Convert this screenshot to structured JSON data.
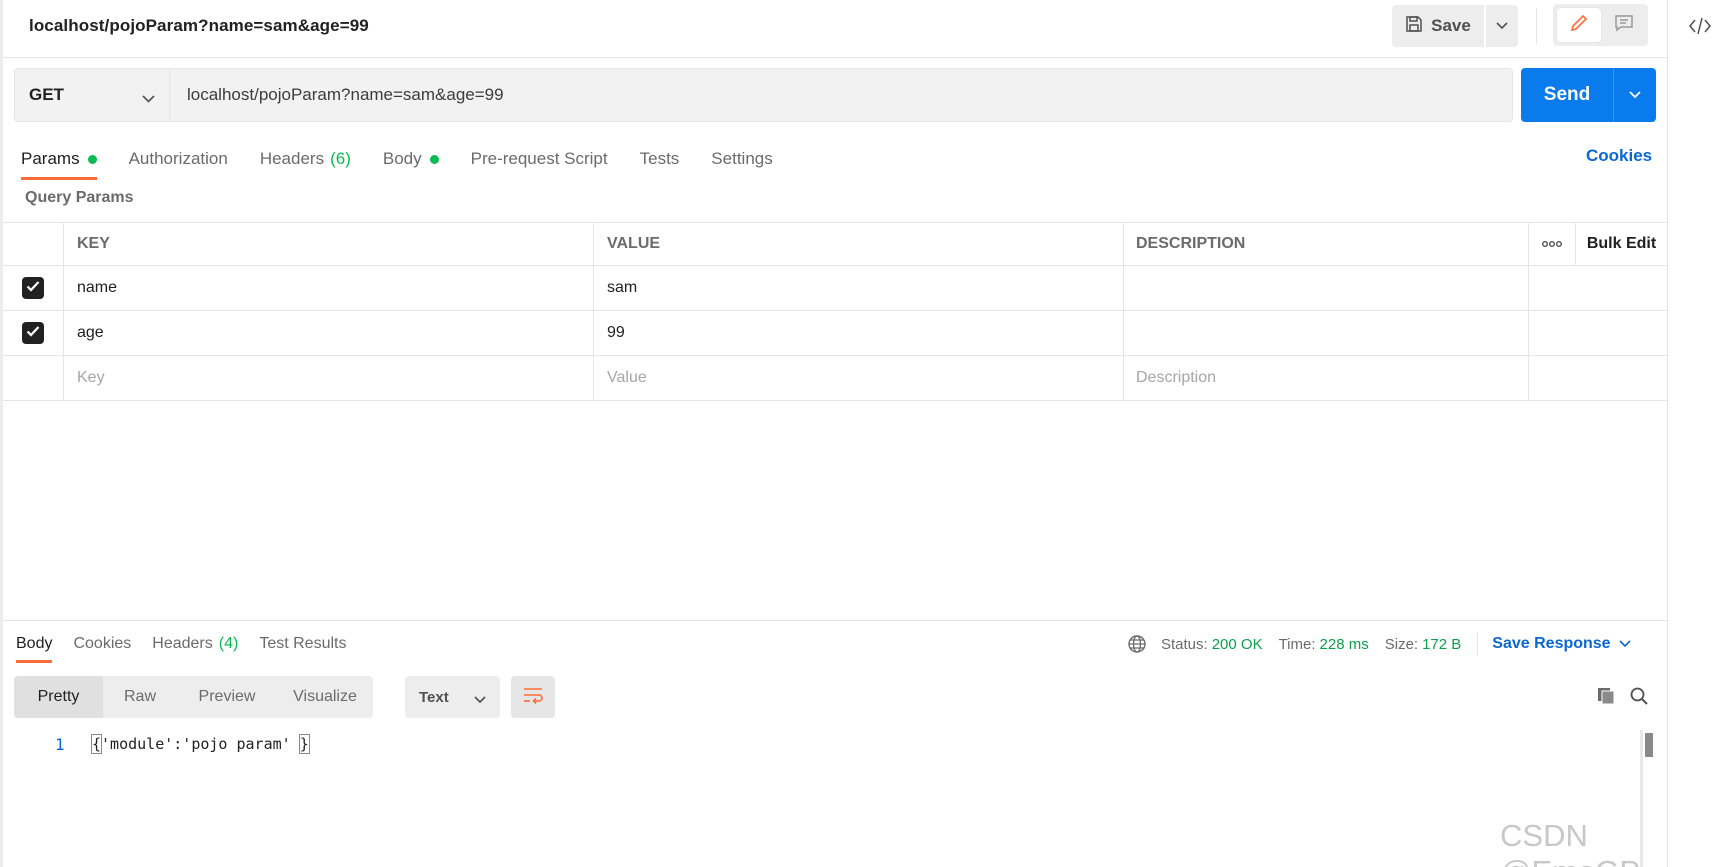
{
  "header": {
    "title": "localhost/pojoParam?name=sam&age=99",
    "save_label": "Save"
  },
  "request": {
    "method": "GET",
    "url": "localhost/pojoParam?name=sam&age=99",
    "send_label": "Send"
  },
  "request_tabs": {
    "params": "Params",
    "authorization": "Authorization",
    "headers": "Headers",
    "headers_count": "(6)",
    "body": "Body",
    "prerequest": "Pre-request Script",
    "tests": "Tests",
    "settings": "Settings",
    "cookies": "Cookies"
  },
  "query_params": {
    "title": "Query Params",
    "columns": {
      "key": "KEY",
      "value": "VALUE",
      "description": "DESCRIPTION",
      "more": "ooo",
      "bulk_edit": "Bulk Edit"
    },
    "rows": [
      {
        "key": "name",
        "value": "sam",
        "description": ""
      },
      {
        "key": "age",
        "value": "99",
        "description": ""
      }
    ],
    "placeholders": {
      "key": "Key",
      "value": "Value",
      "description": "Description"
    }
  },
  "response": {
    "tabs": {
      "body": "Body",
      "cookies": "Cookies",
      "headers": "Headers",
      "headers_count": "(4)",
      "test_results": "Test Results"
    },
    "status_label": "Status:",
    "status_value": "200 OK",
    "time_label": "Time:",
    "time_value": "228 ms",
    "size_label": "Size:",
    "size_value": "172 B",
    "save_response": "Save Response",
    "formats": {
      "pretty": "Pretty",
      "raw": "Raw",
      "preview": "Preview",
      "visualize": "Visualize"
    },
    "type": "Text",
    "lines": [
      {
        "number": "1",
        "open": "{",
        "body": "'module':'pojo param' ",
        "close": "}"
      }
    ]
  },
  "watermark": "CSDN @EmoGP",
  "colors": {
    "accent": "#ff6c37",
    "send": "#097bed",
    "status_ok": "#0ca04b",
    "link": "#0b68d0"
  }
}
